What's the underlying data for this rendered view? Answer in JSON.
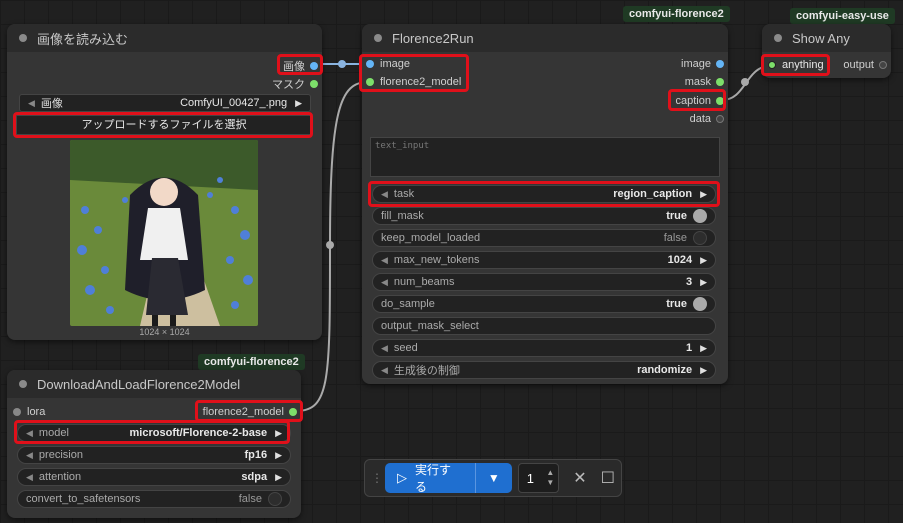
{
  "nodes": {
    "load_image": {
      "title": "画像を読み込む",
      "outputs": {
        "image": "画像",
        "mask": "マスク"
      },
      "image_widget": {
        "label": "画像",
        "value": "ComfyUI_00427_.png"
      },
      "upload_label": "アップロードするファイルを選択",
      "image_size": "1024 × 1024"
    },
    "florence_run": {
      "badge": "comfyui-florence2",
      "title": "Florence2Run",
      "inputs": {
        "image": "image",
        "florence2_model": "florence2_model"
      },
      "outputs": {
        "image": "image",
        "mask": "mask",
        "caption": "caption",
        "data": "data"
      },
      "text_input_placeholder": "text_input",
      "widgets": {
        "task": {
          "label": "task",
          "value": "region_caption"
        },
        "fill_mask": {
          "label": "fill_mask",
          "value": "true"
        },
        "keep_model_loaded": {
          "label": "keep_model_loaded",
          "value": "false"
        },
        "max_new_tokens": {
          "label": "max_new_tokens",
          "value": "1024"
        },
        "num_beams": {
          "label": "num_beams",
          "value": "3"
        },
        "do_sample": {
          "label": "do_sample",
          "value": "true"
        },
        "output_mask_select": {
          "label": "output_mask_select",
          "value": ""
        },
        "seed": {
          "label": "seed",
          "value": "1"
        },
        "control_after_generate": {
          "label": "生成後の制御",
          "value": "randomize"
        }
      }
    },
    "show_any": {
      "badge": "comfyui-easy-use",
      "title": "Show Any",
      "input": "anything",
      "output": "output"
    },
    "download_florence": {
      "badge": "comfyui-florence2",
      "title": "DownloadAndLoadFlorence2Model",
      "input": "lora",
      "output": "florence2_model",
      "widgets": {
        "model": {
          "label": "model",
          "value": "microsoft/Florence-2-base"
        },
        "precision": {
          "label": "precision",
          "value": "fp16"
        },
        "attention": {
          "label": "attention",
          "value": "sdpa"
        },
        "convert_to_safetensors": {
          "label": "convert_to_safetensors",
          "value": "false"
        }
      }
    }
  },
  "toolbar": {
    "run_label": "実行する",
    "queue_count": "1"
  },
  "colors": {
    "image_slot": "#64b5f6",
    "model_slot": "#7ddf6a",
    "caption_slot": "#7ddf6a",
    "highlight": "#e0101a",
    "accent": "#1f6fd0"
  }
}
